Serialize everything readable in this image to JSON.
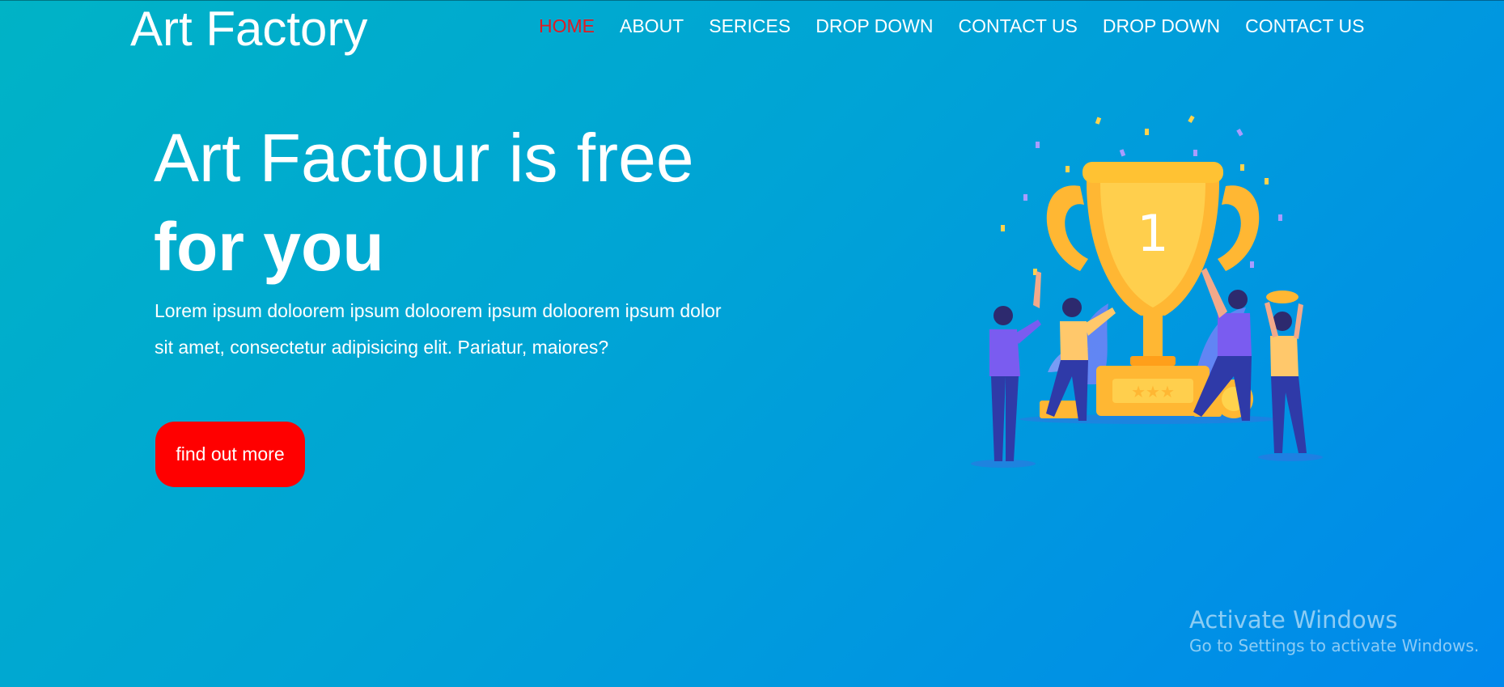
{
  "brand": {
    "name": "Art Factory"
  },
  "nav": {
    "items": [
      {
        "label": "HOME",
        "active": true
      },
      {
        "label": "ABOUT",
        "active": false
      },
      {
        "label": "SERICES",
        "active": false
      },
      {
        "label": "DROP DOWN",
        "active": false
      },
      {
        "label": "CONTACT US",
        "active": false
      },
      {
        "label": "DROP DOWN",
        "active": false
      },
      {
        "label": "CONTACT US",
        "active": false
      }
    ]
  },
  "hero": {
    "title_line1": "Art Factour is free",
    "title_line2": "for you",
    "body": "Lorem ipsum doloorem ipsum doloorem ipsum doloorem ipsum dolor sit amet, consectetur adipisicing elit. Pariatur, maiores?",
    "cta_label": "find out more",
    "illustration": {
      "icon": "trophy-celebration-icon",
      "trophy_number": "1"
    }
  },
  "watermark": {
    "title": "Activate Windows",
    "subtitle": "Go to Settings to activate Windows."
  },
  "colors": {
    "background_start": "#00b3c6",
    "background_end": "#0088ec",
    "nav_active": "#e11b22",
    "cta": "#ff0000",
    "trophy": "#ffb733"
  }
}
